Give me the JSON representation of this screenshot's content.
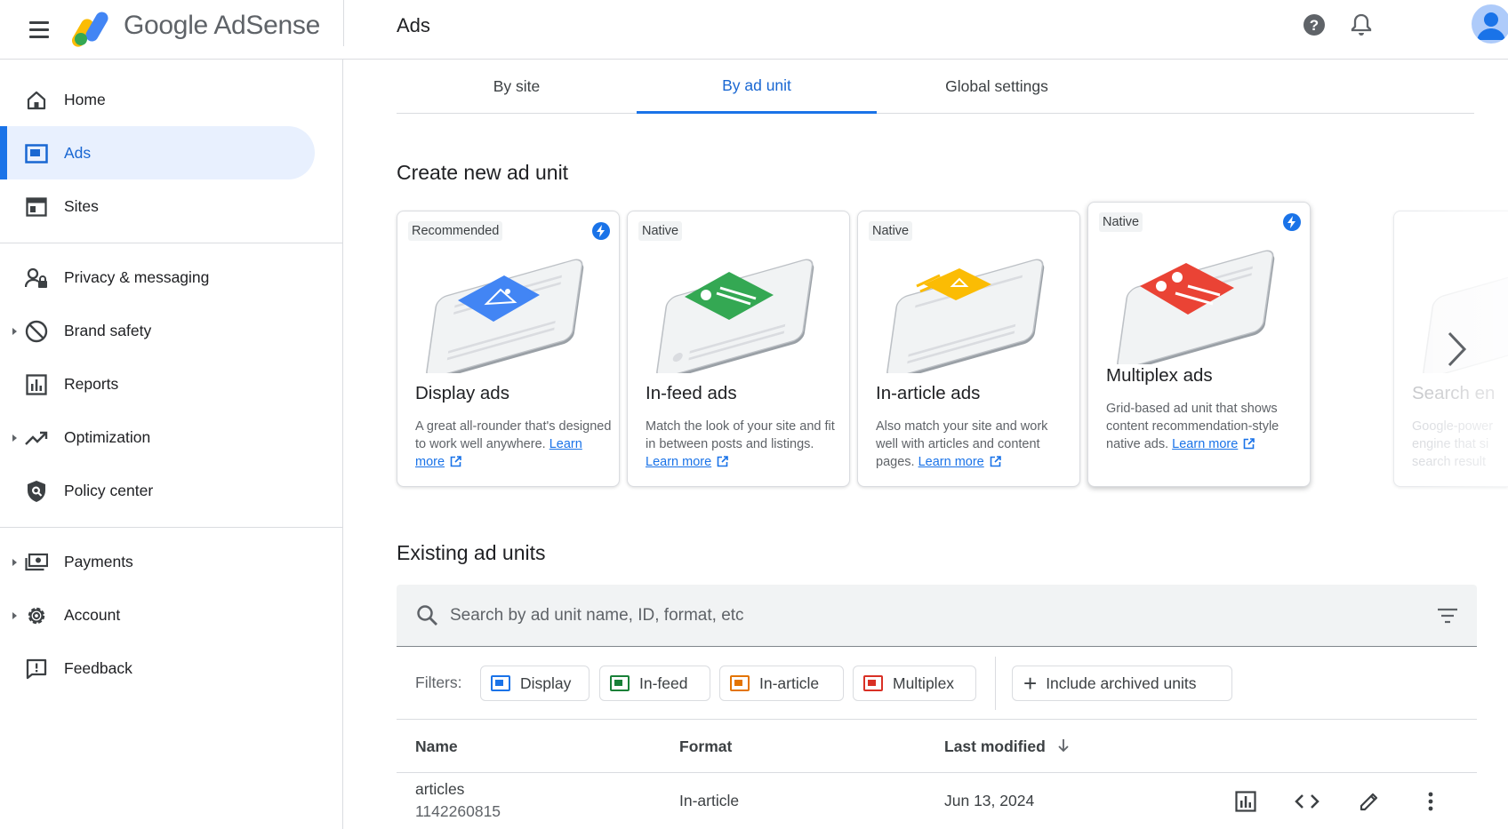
{
  "header": {
    "brand": "Google AdSense",
    "page_title": "Ads"
  },
  "sidebar": {
    "items": [
      {
        "label": "Home",
        "icon": "home-icon"
      },
      {
        "label": "Ads",
        "icon": "ads-icon",
        "active": true
      },
      {
        "label": "Sites",
        "icon": "sites-icon"
      },
      {
        "label": "Privacy & messaging",
        "icon": "privacy-icon"
      },
      {
        "label": "Brand safety",
        "icon": "block-icon",
        "expandable": true
      },
      {
        "label": "Reports",
        "icon": "bar-chart-icon"
      },
      {
        "label": "Optimization",
        "icon": "trending-up-icon",
        "expandable": true
      },
      {
        "label": "Policy center",
        "icon": "shield-icon"
      },
      {
        "label": "Payments",
        "icon": "payments-icon",
        "expandable": true
      },
      {
        "label": "Account",
        "icon": "gear-icon",
        "expandable": true
      },
      {
        "label": "Feedback",
        "icon": "feedback-icon"
      }
    ]
  },
  "tabs": [
    {
      "label": "By site"
    },
    {
      "label": "By ad unit",
      "active": true
    },
    {
      "label": "Global settings"
    }
  ],
  "create_section": {
    "title": "Create new ad unit",
    "cards": [
      {
        "badge": "Recommended",
        "title": "Display ads",
        "desc": "A great all-rounder that's designed to work well anywhere.",
        "learn_more": "Learn more",
        "accent": "#4285f4"
      },
      {
        "badge": "Native",
        "title": "In-feed ads",
        "desc": "Match the look of your site and fit in between posts and listings.",
        "learn_more": "Learn more",
        "accent": "#34a853"
      },
      {
        "badge": "Native",
        "title": "In-article ads",
        "desc": "Also match your site and work well with articles and content pages.",
        "learn_more": "Learn more",
        "accent": "#fbbc04"
      },
      {
        "badge": "Native",
        "title": "Multiplex ads",
        "desc": "Grid-based ad unit that shows content recommendation-style native ads.",
        "learn_more": "Learn more",
        "accent": "#ea4335"
      }
    ],
    "partial_card": {
      "title": "Search en",
      "desc_lines": [
        "Google-power",
        "engine that si",
        "search result"
      ]
    }
  },
  "existing_section": {
    "title": "Existing ad units",
    "search_placeholder": "Search by ad unit name, ID, format, etc",
    "filters_label": "Filters:",
    "filter_chips": [
      {
        "label": "Display",
        "color": "#1a73e8"
      },
      {
        "label": "In-feed",
        "color": "#188038"
      },
      {
        "label": "In-article",
        "color": "#e37400"
      },
      {
        "label": "Multiplex",
        "color": "#d93025"
      }
    ],
    "archived_chip": "Include archived units",
    "columns": {
      "name": "Name",
      "format": "Format",
      "last_modified": "Last modified"
    },
    "rows": [
      {
        "name": "articles",
        "id": "1142260815",
        "format": "In-article",
        "last_modified": "Jun 13, 2024"
      }
    ]
  },
  "colors": {
    "accent": "#1a73e8",
    "active_bg": "#e8f0fe"
  }
}
